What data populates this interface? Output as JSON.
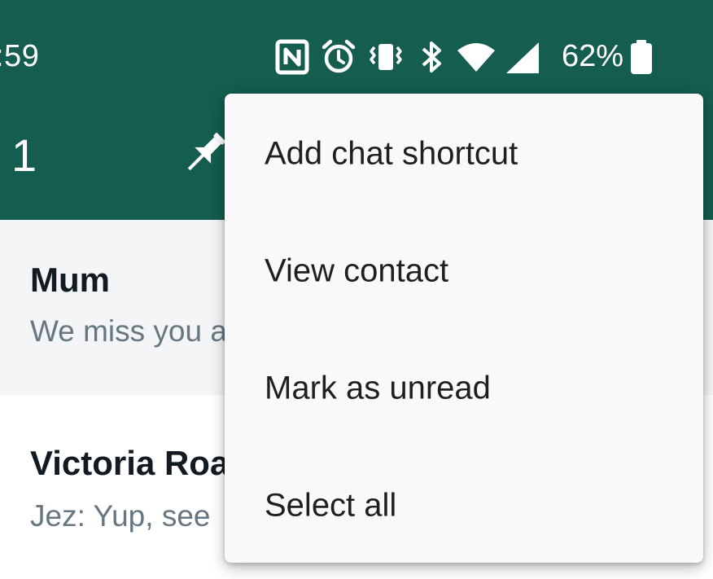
{
  "status_bar": {
    "time": ":59",
    "battery_percent": "62%",
    "icons": [
      "nfc-icon",
      "alarm-icon",
      "vibrate-icon",
      "bluetooth-icon",
      "wifi-icon",
      "cell-signal-icon",
      "battery-icon"
    ]
  },
  "app_bar": {
    "selected_count": "1",
    "actions": [
      "pin-icon"
    ]
  },
  "chats": [
    {
      "name": "Mum",
      "preview": "We miss you a",
      "selected": true
    },
    {
      "name": "Victoria Roa",
      "preview": "Jez: Yup, see",
      "selected": false
    }
  ],
  "menu": {
    "items": [
      {
        "label": "Add chat shortcut"
      },
      {
        "label": "View contact"
      },
      {
        "label": "Mark as unread"
      },
      {
        "label": "Select all"
      }
    ]
  },
  "colors": {
    "header": "#145d4f",
    "selected_row": "#f3f5f6",
    "menu_bg": "#f9f9f9",
    "name_text": "#111b21",
    "preview_text": "#667781"
  }
}
